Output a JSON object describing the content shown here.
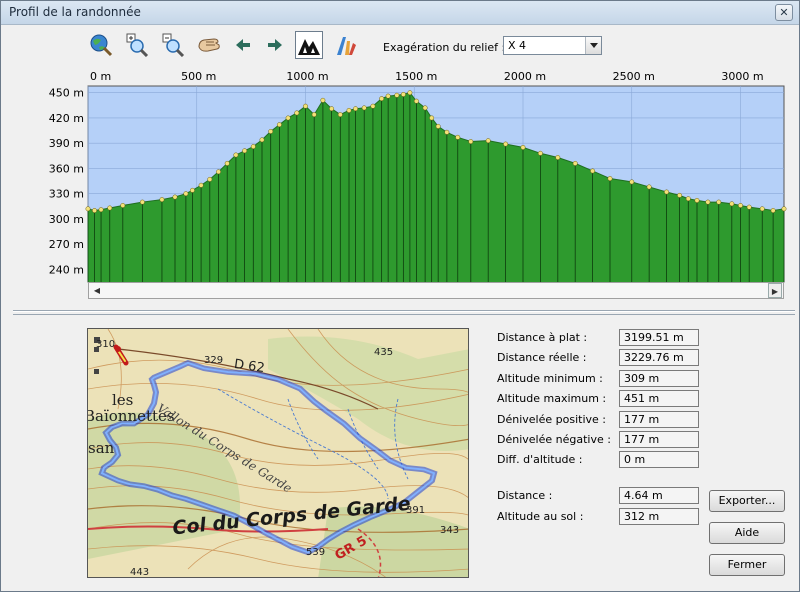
{
  "window": {
    "title": "Profil de la randonnée",
    "close_label": "✕"
  },
  "toolbar": {
    "tools": [
      {
        "name": "globe-search-icon"
      },
      {
        "name": "zoom-in-icon"
      },
      {
        "name": "zoom-out-icon"
      },
      {
        "name": "pan-hand-icon"
      },
      {
        "name": "arrow-left-icon"
      },
      {
        "name": "arrow-right-icon"
      },
      {
        "name": "terrain-trees-icon",
        "active": true
      },
      {
        "name": "compass-pencil-icon"
      }
    ],
    "relief_label": "Exagération du relief :",
    "relief_value": "X 4"
  },
  "chart_data": {
    "type": "area",
    "xlabel": "",
    "ylabel": "",
    "x_ticks": [
      "0 m",
      "500 m",
      "1000 m",
      "1500 m",
      "2000 m",
      "2500 m",
      "3000 m"
    ],
    "x_tick_values": [
      0,
      500,
      1000,
      1500,
      2000,
      2500,
      3000
    ],
    "y_ticks": [
      "450 m",
      "420 m",
      "390 m",
      "360 m",
      "330 m",
      "300 m",
      "270 m",
      "240 m"
    ],
    "y_tick_values": [
      450,
      420,
      390,
      360,
      330,
      300,
      270,
      240
    ],
    "xlim": [
      0,
      3200
    ],
    "ylim": [
      225,
      458
    ],
    "grid": true,
    "colors": {
      "background": "#b5d0f8",
      "fill": "#2e9a2e",
      "stroke": "#1f6e1f",
      "point": "#f2e27a",
      "grid": "#8aa8d8"
    },
    "x": [
      0,
      30,
      60,
      100,
      160,
      250,
      340,
      400,
      450,
      480,
      520,
      560,
      600,
      640,
      680,
      720,
      760,
      800,
      840,
      880,
      920,
      960,
      1000,
      1040,
      1080,
      1120,
      1160,
      1200,
      1230,
      1270,
      1310,
      1350,
      1380,
      1420,
      1450,
      1480,
      1510,
      1550,
      1580,
      1610,
      1650,
      1700,
      1760,
      1840,
      1920,
      2000,
      2080,
      2160,
      2240,
      2320,
      2400,
      2500,
      2580,
      2660,
      2720,
      2760,
      2800,
      2850,
      2900,
      2960,
      3000,
      3040,
      3100,
      3150,
      3200
    ],
    "y": [
      312,
      310,
      311,
      313,
      316,
      320,
      323,
      326,
      330,
      334,
      340,
      347,
      356,
      366,
      376,
      381,
      386,
      394,
      404,
      412,
      420,
      426,
      434,
      424,
      441,
      431,
      424,
      429,
      431,
      432,
      434,
      443,
      446,
      447,
      448,
      450,
      440,
      432,
      420,
      410,
      403,
      397,
      392,
      393,
      389,
      385,
      378,
      373,
      366,
      357,
      348,
      344,
      338,
      332,
      328,
      324,
      322,
      320,
      320,
      318,
      316,
      314,
      312,
      310,
      312
    ]
  },
  "map": {
    "labels": [
      "310",
      "329",
      "D 62",
      "435",
      "les",
      "Baïonnettes",
      "san",
      "Vallon du Corps de Garde",
      "Col du Corps de Garde",
      "391",
      "343",
      "539",
      "GR 5",
      "443"
    ]
  },
  "stats": [
    {
      "label": "Distance à plat :",
      "value": "3199.51 m"
    },
    {
      "label": "Distance réelle :",
      "value": "3229.76 m"
    },
    {
      "label": "Altitude minimum :",
      "value": "309 m"
    },
    {
      "label": "Altitude maximum :",
      "value": "451 m"
    },
    {
      "label": "Dénivelée positive :",
      "value": "177 m"
    },
    {
      "label": "Dénivelée négative :",
      "value": "177 m"
    },
    {
      "label": "Diff. d'altitude :",
      "value": "0 m"
    }
  ],
  "cursor": [
    {
      "label": "Distance :",
      "value": "4.64 m"
    },
    {
      "label": "Altitude au sol :",
      "value": "312 m"
    }
  ],
  "buttons": {
    "export": "Exporter...",
    "help": "Aide",
    "close": "Fermer"
  }
}
